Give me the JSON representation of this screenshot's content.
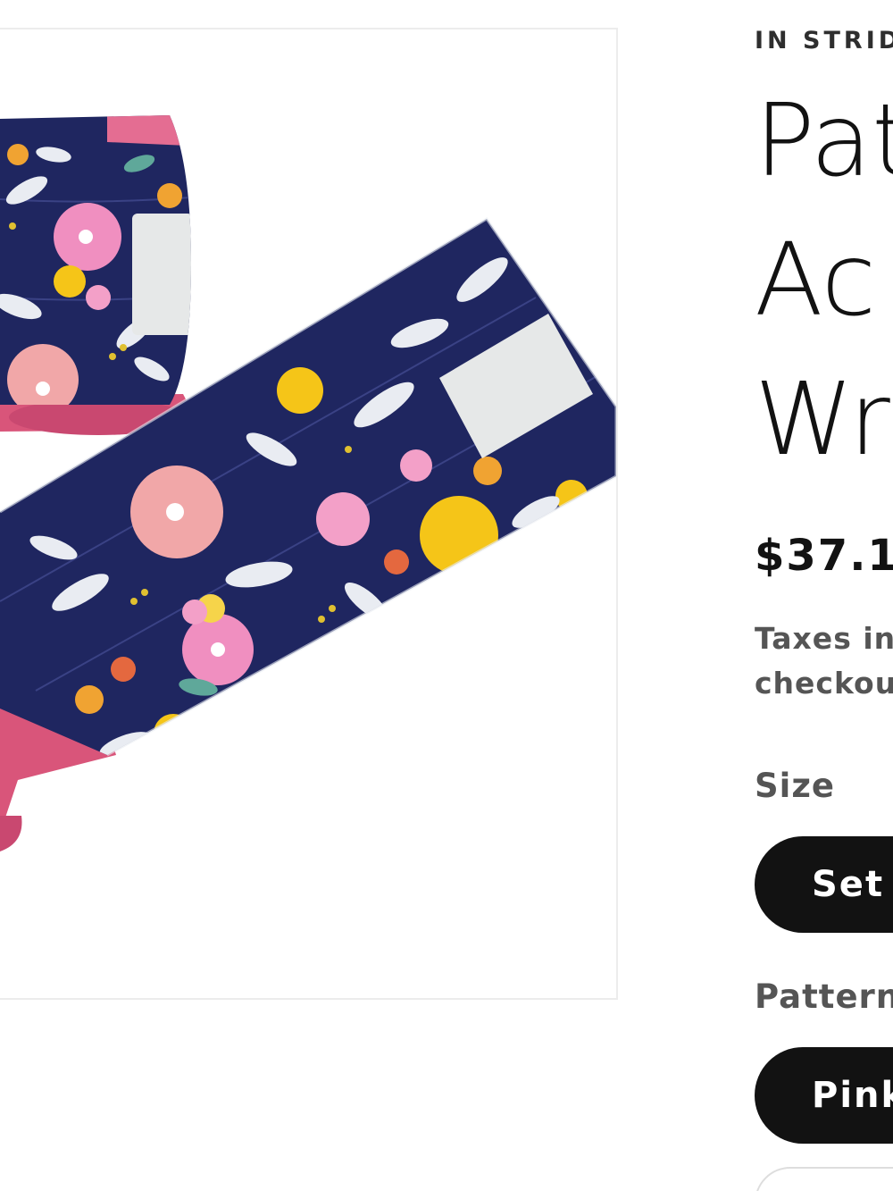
{
  "product": {
    "vendor": "IN STRID",
    "title_lines": [
      "Pat",
      "Ac",
      "Wr"
    ],
    "price": "$37.1(",
    "tax_lines": [
      "Taxes in",
      "checkou"
    ],
    "image_alt": "Floral polo wraps with pink fleece"
  },
  "options": {
    "size": {
      "label": "Size",
      "selected": "Set"
    },
    "pattern": {
      "label": "Pattern",
      "selected": "Pink"
    }
  },
  "colors": {
    "navy": "#1f2660",
    "fleece_pink": "#d9557a",
    "velcro": "#e6e8e8",
    "pill": "#121212"
  }
}
